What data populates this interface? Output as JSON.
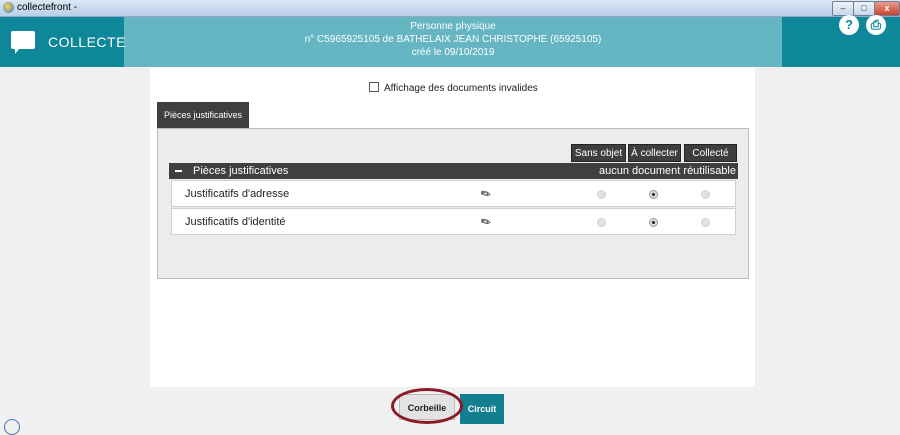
{
  "window": {
    "title": "collectefront -",
    "min_glyph": "–",
    "max_glyph": "□",
    "close_glyph": "x"
  },
  "header": {
    "brand": "COLLECTE",
    "line1": "Personne physique",
    "line2": "n° C5965925105 de BATHELAIX JEAN CHRISTOPHE (65925105)",
    "line3": "créé le 09/10/2019",
    "help_glyph": "?",
    "print_glyph": "⎙"
  },
  "filter": {
    "label": "Affichage des documents invalides",
    "checked": false
  },
  "tab": {
    "label": "Pièces justificatives"
  },
  "columns": [
    "Sans objet",
    "À collecter",
    "Collecté"
  ],
  "section": {
    "title": "Pièces justificatives",
    "right": "aucun document réutilisable"
  },
  "rows": [
    {
      "label": "Justificatifs d'adresse",
      "icon": "scanner-icon",
      "selected": "À collecter"
    },
    {
      "label": "Justificatifs d'identité",
      "icon": "scanner-icon",
      "selected": "À collecter"
    }
  ],
  "doc_glyph": "✎",
  "footer": {
    "corbeille": "Corbeille",
    "circuit": "Circuit"
  },
  "colors": {
    "header": "#65b6c2",
    "accent": "#0e8798",
    "highlight": "#8b1a28"
  }
}
